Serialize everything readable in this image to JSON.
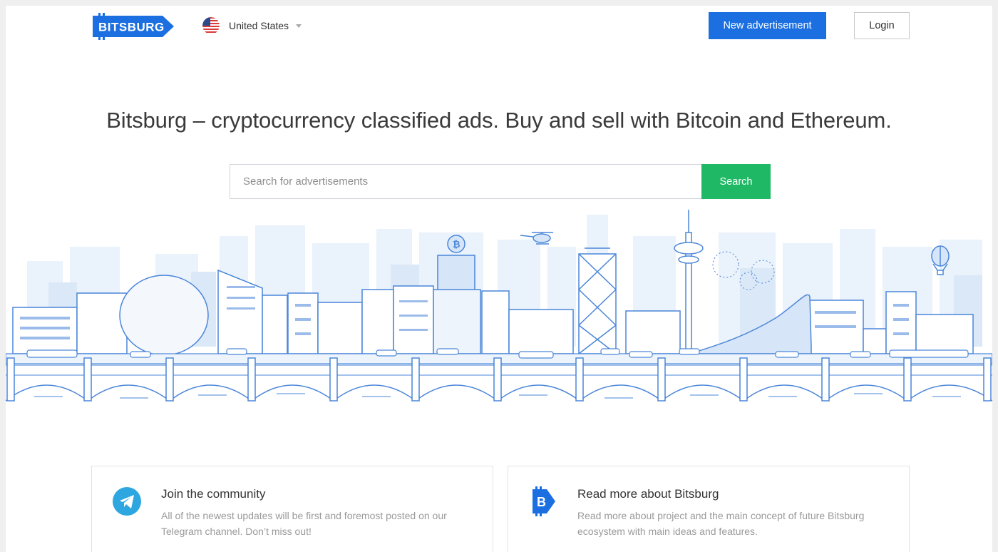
{
  "header": {
    "logo_text": "BITSBURG",
    "country": "United States",
    "new_ad_label": "New advertisement",
    "login_label": "Login"
  },
  "hero": {
    "title": "Bitsburg – cryptocurrency classified ads. Buy and sell with Bitcoin and Ethereum.",
    "search_placeholder": "Search for advertisements",
    "search_button": "Search"
  },
  "cards": [
    {
      "title": "Join the community",
      "text": "All of the newest updates will be first and foremost posted on our Telegram channel. Don’t miss out!",
      "icon": "telegram-icon"
    },
    {
      "title": "Read more about Bitsburg",
      "text": "Read more about project and the main concept of future Bitsburg ecosystem with main ideas and features.",
      "icon": "bitsburg-b-icon"
    }
  ],
  "colors": {
    "brand_blue": "#1b6fe0",
    "search_green": "#1fb865",
    "telegram_blue": "#2ea6e0",
    "skyline_line": "#4a86d9",
    "skyline_fill": "#d6e6f8"
  }
}
